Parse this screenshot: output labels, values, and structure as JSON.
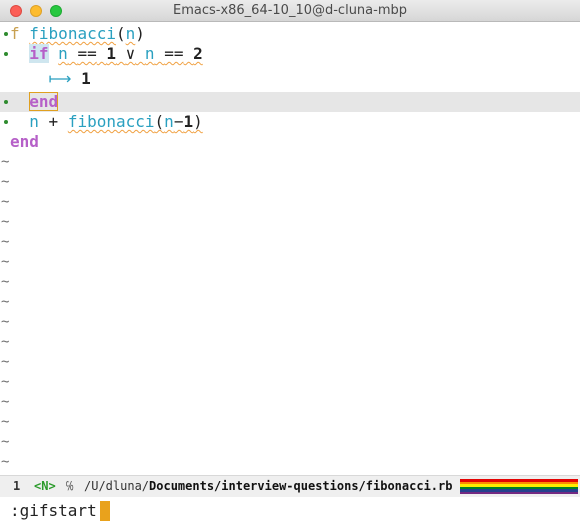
{
  "window": {
    "title": "Emacs-x86_64-10_10@d-cluna-mbp"
  },
  "editor": {
    "line1": {
      "kw": "f",
      "fn": "fibonacci",
      "lp": "(",
      "arg": "n",
      "rp": ")"
    },
    "line2": {
      "kw": "if",
      "v1": "n",
      "op1": "==",
      "n1": "1",
      "or": "∨",
      "v2": "n",
      "op2": "==",
      "n2": "2"
    },
    "line3": {
      "arrow": "⟼",
      "n": "1"
    },
    "line4": {
      "kw": "end"
    },
    "line5": {
      "v": "n",
      "plus": "+",
      "fn": "fibonacci",
      "lp": "(",
      "arg": "n",
      "minus": "−",
      "n": "1",
      "rp": ")"
    },
    "line6": {
      "kw": "end"
    },
    "tilde": "~"
  },
  "modeline": {
    "window_number": "1",
    "evil_state": "<N>",
    "path_icon": "℅",
    "path_prefix": "/U/dluna/",
    "path_bold": "Documents/interview-questions/fibonacci.rb"
  },
  "minibuffer": {
    "command": ":gifstart"
  },
  "colors": {
    "keyword": "#b660c8",
    "function": "#2aa0c0",
    "cursor": "#e9a21c",
    "highlight": "#e6e6e6",
    "rainbow": [
      "#e40303",
      "#ff8c00",
      "#ffed00",
      "#008026",
      "#24408e",
      "#732982"
    ]
  }
}
